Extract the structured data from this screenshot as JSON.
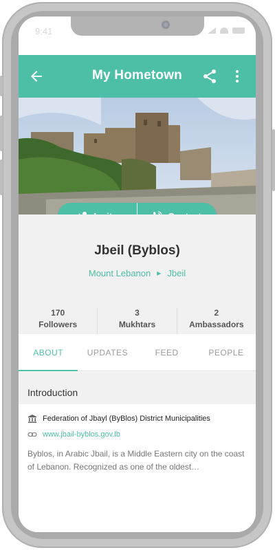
{
  "status_bar": {
    "time": "9:41"
  },
  "appbar": {
    "title": "My Hometown",
    "back_icon": "arrow-back-icon",
    "share_icon": "share-icon",
    "menu_icon": "more-vert-icon"
  },
  "actions": {
    "invite_label": "Invite",
    "contact_label": "Contact"
  },
  "profile": {
    "title": "Jbeil (Byblos)",
    "breadcrumb": [
      "Mount Lebanon",
      "Jbeil"
    ],
    "stats": [
      {
        "value": "170",
        "label": "Followers"
      },
      {
        "value": "3",
        "label": "Mukhtars"
      },
      {
        "value": "2",
        "label": "Ambassadors"
      }
    ]
  },
  "tabs": [
    "ABOUT",
    "UPDATES",
    "FEED",
    "PEOPLE"
  ],
  "active_tab": "ABOUT",
  "about": {
    "section_title": "Introduction",
    "organization": "Federation of Jbayl (ByBlos) District Municipalities",
    "website": "www.jbail-byblos.gov.lb",
    "description": "Byblos, in Arabic Jbail, is a Middle Eastern city on the coast of Lebanon. Recognized as one of the oldest…"
  },
  "colors": {
    "accent": "#4dbfa7",
    "background": "#f1f1f1"
  }
}
